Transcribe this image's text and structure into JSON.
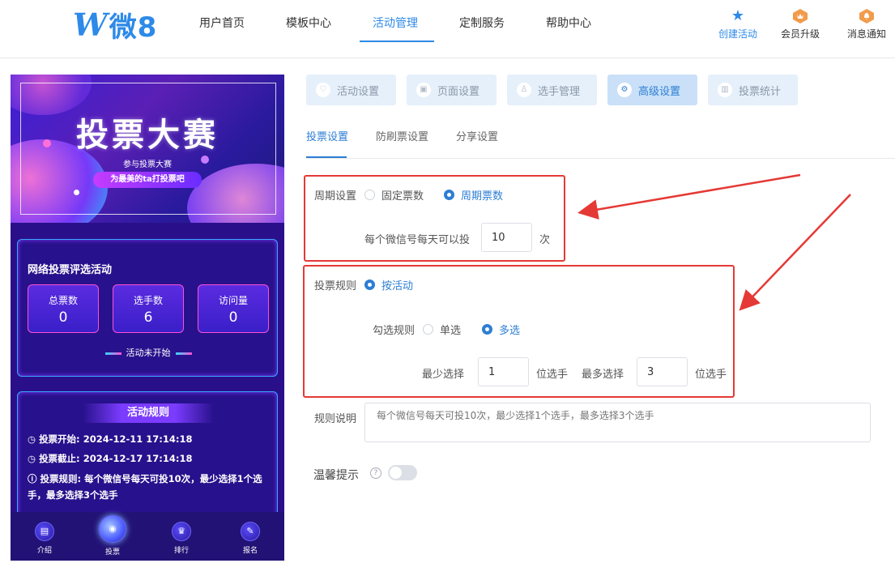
{
  "brand": {
    "logo_text": "微8",
    "logo_mark": "W"
  },
  "nav": {
    "items": [
      "用户首页",
      "模板中心",
      "活动管理",
      "定制服务",
      "帮助中心"
    ],
    "active_index": 2
  },
  "top_actions": {
    "create": "创建活动",
    "upgrade": "会员升级",
    "notify": "消息通知"
  },
  "preview": {
    "banner_title": "投票大赛",
    "banner_sub1": "参与投票大赛",
    "banner_sub2": "为最美的ta打投票吧",
    "activity_name": "网络投票评选活动",
    "stats": [
      {
        "label": "总票数",
        "value": "0"
      },
      {
        "label": "选手数",
        "value": "6"
      },
      {
        "label": "访问量",
        "value": "0"
      }
    ],
    "status": "活动未开始",
    "rules_title": "活动规则",
    "rules": {
      "start_label": "投票开始:",
      "start_value": "2024-12-11 17:14:18",
      "end_label": "投票截止:",
      "end_value": "2024-12-17 17:14:18",
      "rule_label": "投票规则:",
      "rule_value": "每个微信号每天可投10次，最少选择1个选手，最多选择3个选手"
    },
    "tabbar": [
      "介绍",
      "投票",
      "排行",
      "报名"
    ]
  },
  "config_tabs": [
    "活动设置",
    "页面设置",
    "选手管理",
    "高级设置",
    "投票统计"
  ],
  "config_active": 3,
  "sub_tabs": [
    "投票设置",
    "防刷票设置",
    "分享设置"
  ],
  "form": {
    "period_label": "周期设置",
    "period_opt_fixed": "固定票数",
    "period_opt_cycle": "周期票数",
    "per_day_label": "每个微信号每天可以投",
    "per_day_value": "10",
    "per_day_unit": "次",
    "rule_label": "投票规则",
    "rule_opt": "按活动",
    "check_label": "勾选规则",
    "check_single": "单选",
    "check_multi": "多选",
    "min_label": "最少选择",
    "min_value": "1",
    "min_unit": "位选手",
    "max_label": "最多选择",
    "max_value": "3",
    "max_unit": "位选手",
    "desc_label": "规则说明",
    "desc_placeholder": "每个微信号每天可投10次，最少选择1个选手，最多选择3个选手",
    "tip_label": "温馨提示"
  },
  "colors": {
    "accent": "#2d7ed4",
    "highlight": "#e53935"
  }
}
